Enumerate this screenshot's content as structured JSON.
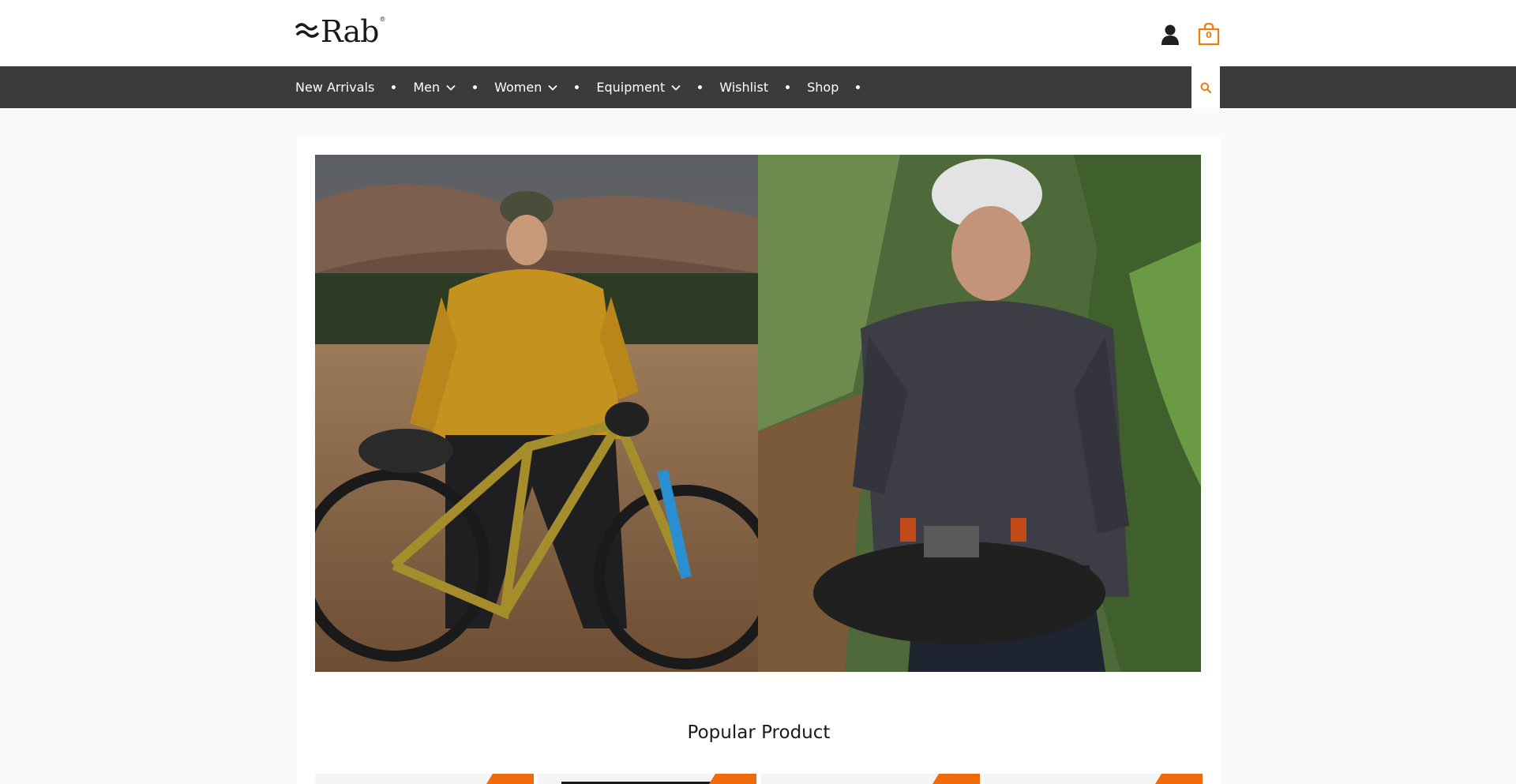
{
  "brand": {
    "name": "Rab",
    "registered": "®",
    "accent_color": "#f07c0a",
    "nav_bg": "#3b3b3b"
  },
  "header": {
    "user_icon": "user-icon",
    "cart_icon": "shopping-bag-icon",
    "cart_count": "0"
  },
  "nav": {
    "items": [
      {
        "label": "New Arrivals",
        "has_dropdown": false
      },
      {
        "label": "Men",
        "has_dropdown": true
      },
      {
        "label": "Women",
        "has_dropdown": true
      },
      {
        "label": "Equipment",
        "has_dropdown": true
      },
      {
        "label": "Wishlist",
        "has_dropdown": false
      },
      {
        "label": "Shop",
        "has_dropdown": false
      }
    ],
    "search_icon": "search-icon"
  },
  "hero": {
    "left_image": "cyclist-yellow-jacket-mountain-bike",
    "right_image": "cyclist-grey-jacket-forest-bike"
  },
  "popular": {
    "title": "Popular Product",
    "badge_color": "#f06a0a"
  }
}
